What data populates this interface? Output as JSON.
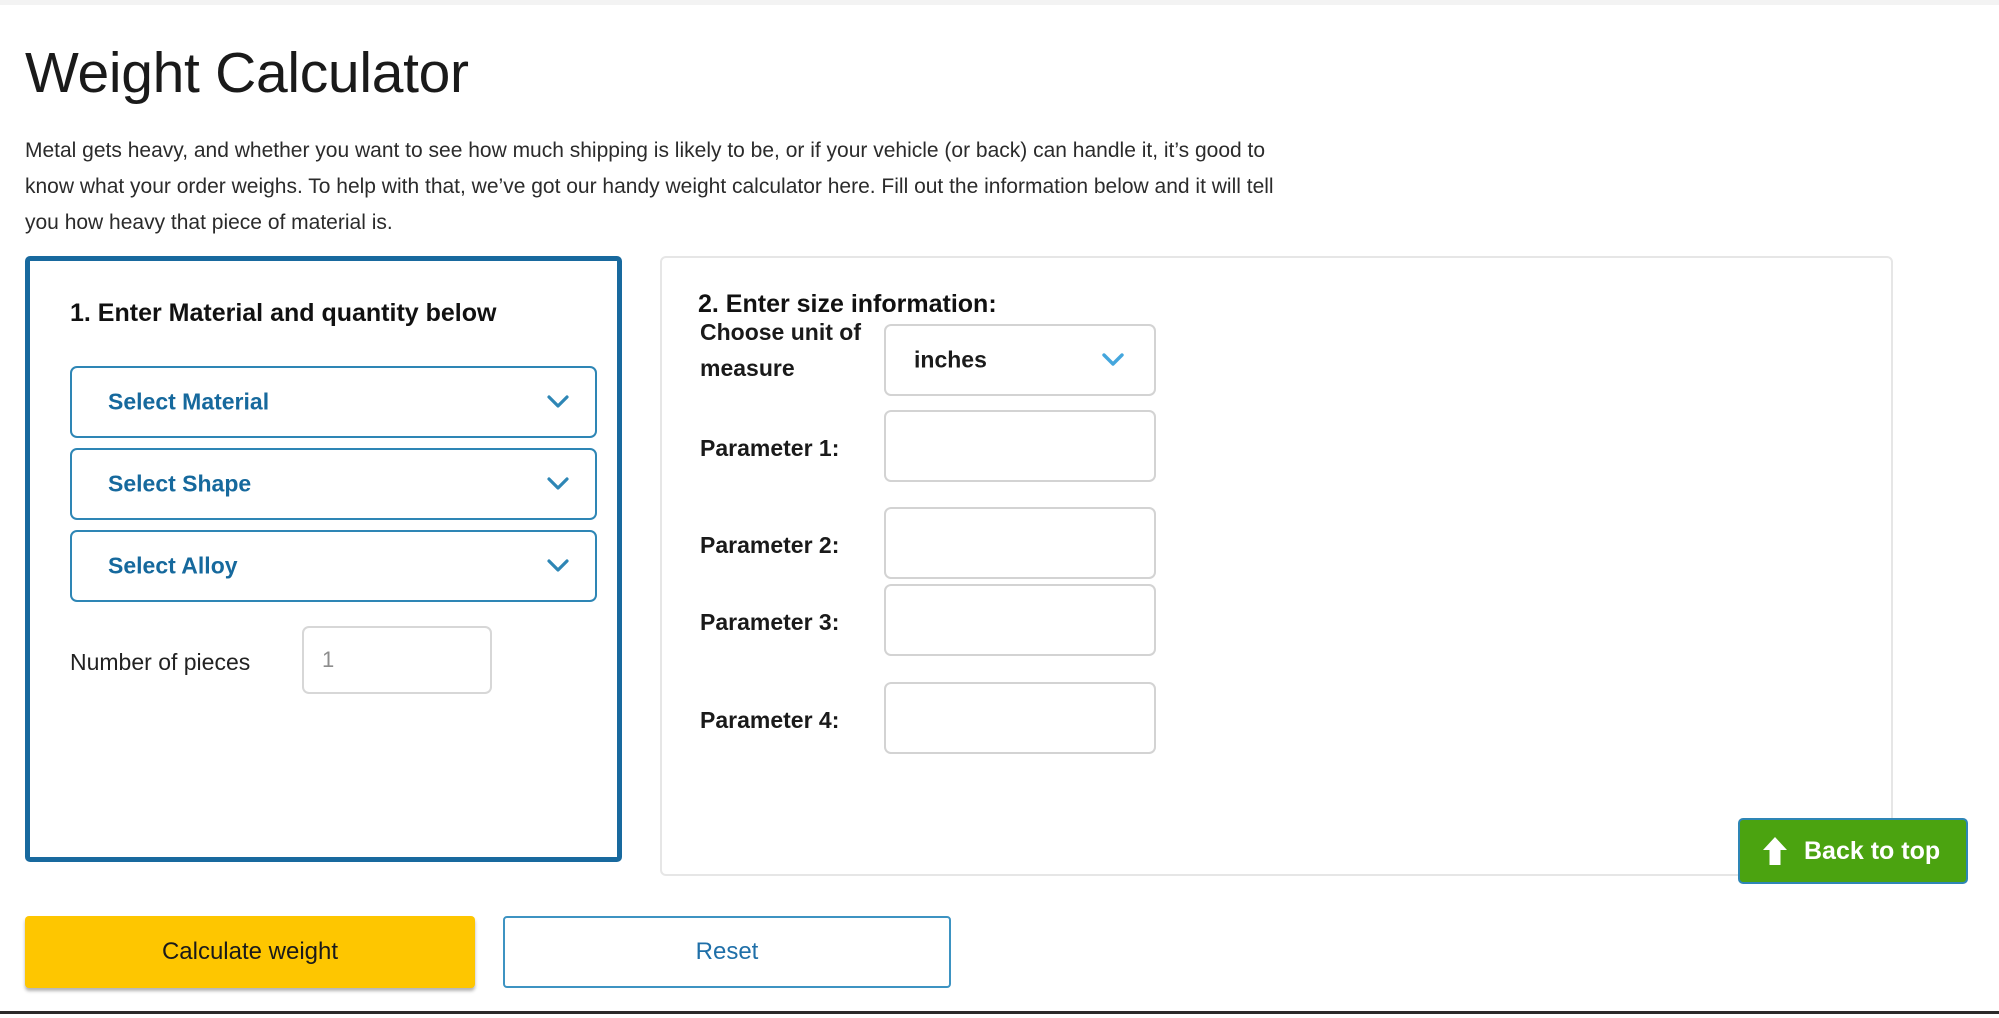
{
  "header": {
    "title": "Weight Calculator",
    "intro": "Metal gets heavy, and whether you want to see how much shipping is likely to be, or if your vehicle (or back) can handle it, it’s good to know what your order weighs. To help with that, we’ve got our handy weight calculator here. Fill out the information below and it will tell you how heavy that piece of material is."
  },
  "step1": {
    "heading": "1. Enter Material and quantity below",
    "selects": [
      {
        "label": "Select Material",
        "icon": "chevron-down-icon"
      },
      {
        "label": "Select Shape",
        "icon": "chevron-down-icon"
      },
      {
        "label": "Select Alloy",
        "icon": "chevron-down-icon"
      }
    ],
    "pieces": {
      "label": "Number of pieces",
      "value": "",
      "placeholder": "1"
    }
  },
  "step2": {
    "heading": "2. Enter size information:",
    "unit": {
      "label": "Choose unit of measure",
      "label_line1": "Choose unit of",
      "label_line2": "measure",
      "value": "inches",
      "icon": "chevron-down-icon"
    },
    "parameters": [
      {
        "label": "Parameter 1:",
        "value": "",
        "placeholder": ""
      },
      {
        "label": "Parameter 2:",
        "value": "",
        "placeholder": ""
      },
      {
        "label": "Parameter 3:",
        "value": "",
        "placeholder": ""
      },
      {
        "label": "Parameter 4:",
        "value": "",
        "placeholder": ""
      }
    ]
  },
  "actions": {
    "calculate": "Calculate weight",
    "reset": "Reset"
  },
  "back_to_top": {
    "label": "Back to top",
    "icon": "arrow-up-icon"
  },
  "colors": {
    "panel_accent": "#18699e",
    "link_blue": "#16699d",
    "calculate_yellow": "#fec600",
    "back_to_top_green": "#4ba310",
    "border_grey": "#d3d3d3"
  }
}
